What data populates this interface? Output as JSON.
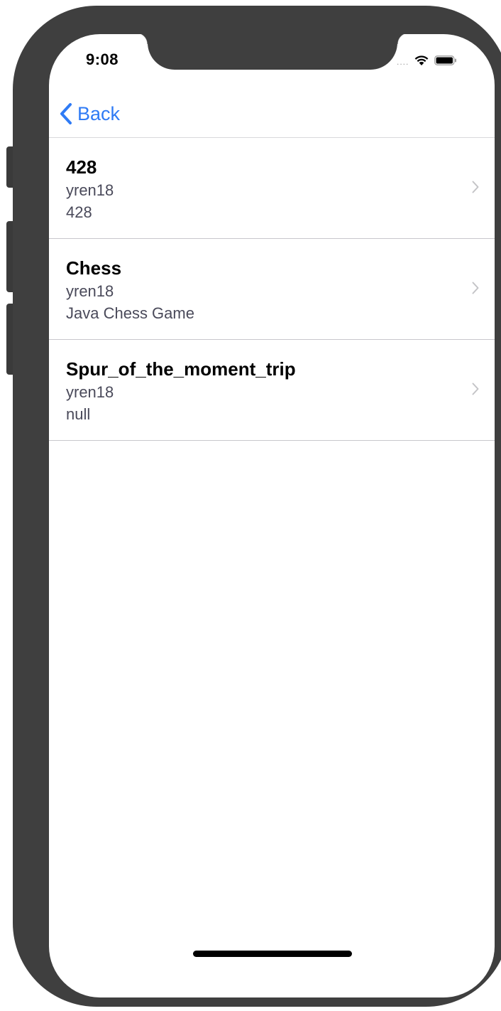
{
  "status_bar": {
    "time": "9:08",
    "signal": "....",
    "wifi_icon": "wifi-icon",
    "battery_icon": "battery-icon"
  },
  "nav": {
    "back_label": "Back",
    "back_icon": "chevron-left-icon",
    "accent_color": "#2f7bf5"
  },
  "repositories": [
    {
      "title": "428",
      "owner": "yren18",
      "description": "428"
    },
    {
      "title": "Chess",
      "owner": "yren18",
      "description": "Java Chess Game"
    },
    {
      "title": "Spur_of_the_moment_trip",
      "owner": "yren18",
      "description": "null"
    }
  ]
}
